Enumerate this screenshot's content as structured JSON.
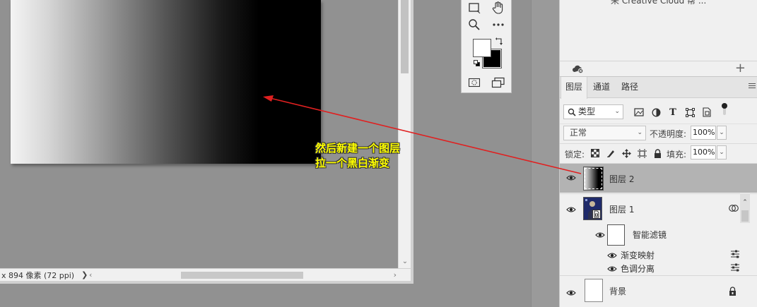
{
  "status_bar": {
    "info": "x 894 像素 (72 ppi)",
    "arrow": "❯"
  },
  "annotation": {
    "line1": "然后新建一个图层",
    "line2": "拉一个黑白渐变"
  },
  "panel_upper": {
    "cc_link": "来 Creative Cloud 帮 ..."
  },
  "tabs": [
    {
      "label": "图层",
      "active": true
    },
    {
      "label": "通道",
      "active": false
    },
    {
      "label": "路径",
      "active": false
    }
  ],
  "filter": {
    "kind_label": "类型"
  },
  "blend": {
    "mode": "正常",
    "opacity_label": "不透明度:",
    "opacity_value": "100%"
  },
  "lock": {
    "label": "锁定:",
    "fill_label": "填充:",
    "fill_value": "100%"
  },
  "layers": {
    "layer2": {
      "name": "图层 2",
      "selected": true
    },
    "layer1": {
      "name": "图层 1"
    },
    "smart_filters": {
      "name": "智能滤镜"
    },
    "filter_gradient_map": {
      "name": "渐变映射"
    },
    "filter_posterize": {
      "name": "色调分离"
    },
    "background": {
      "name": "背景"
    }
  },
  "colors": {
    "foreground": "#ffffff",
    "background": "#000000",
    "annotation_text": "#ffff00",
    "arrow": "#e02020",
    "selected_layer": "#b3b3b3"
  }
}
